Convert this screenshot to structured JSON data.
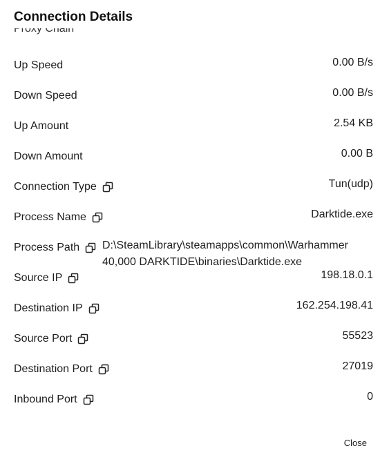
{
  "dialog": {
    "title": "Connection Details",
    "clipped_label": "Proxy Chain",
    "close_label": "Close"
  },
  "rows": [
    {
      "label": "Up Speed",
      "value": "0.00 B/s",
      "copy": false
    },
    {
      "label": "Down Speed",
      "value": "0.00 B/s",
      "copy": false
    },
    {
      "label": "Up Amount",
      "value": "2.54 KB",
      "copy": false
    },
    {
      "label": "Down Amount",
      "value": "0.00 B",
      "copy": false
    },
    {
      "label": "Connection Type",
      "value": "Tun(udp)",
      "copy": true
    },
    {
      "label": "Process Name",
      "value": "Darktide.exe",
      "copy": true
    },
    {
      "label": "Process Path",
      "value": "D:\\SteamLibrary\\steamapps\\common\\Warhammer 40,000 DARKTIDE\\binaries\\Darktide.exe",
      "copy": true
    },
    {
      "label": "Source IP",
      "value": "198.18.0.1",
      "copy": true
    },
    {
      "label": "Destination IP",
      "value": "162.254.198.41",
      "copy": true
    },
    {
      "label": "Source Port",
      "value": "55523",
      "copy": true
    },
    {
      "label": "Destination Port",
      "value": "27019",
      "copy": true
    },
    {
      "label": "Inbound Port",
      "value": "0",
      "copy": true
    }
  ]
}
